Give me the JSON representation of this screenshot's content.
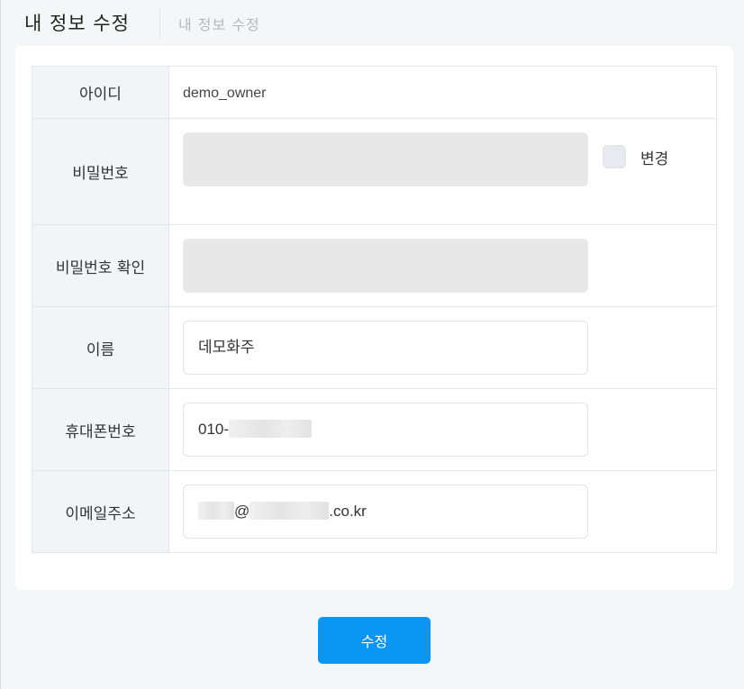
{
  "header": {
    "title": "내 정보 수정",
    "breadcrumb": "내 정보 수정"
  },
  "form": {
    "id": {
      "label": "아이디",
      "value": "demo_owner"
    },
    "password": {
      "label": "비밀번호",
      "value": "",
      "change_label": "변경",
      "change_checked": false
    },
    "password_confirm": {
      "label": "비밀번호 확인",
      "value": ""
    },
    "name": {
      "label": "이름",
      "value": "데모화주"
    },
    "phone": {
      "label": "휴대폰번호",
      "value_visible": "010-"
    },
    "email": {
      "label": "이메일주소",
      "at": "@",
      "suffix": ".co.kr"
    }
  },
  "submit_label": "수정",
  "colors": {
    "page_bg": "#f5f6f8",
    "label_bg": "#f2f5f8",
    "disabled_input": "#e8e8e8",
    "primary": "#0a96f0"
  }
}
